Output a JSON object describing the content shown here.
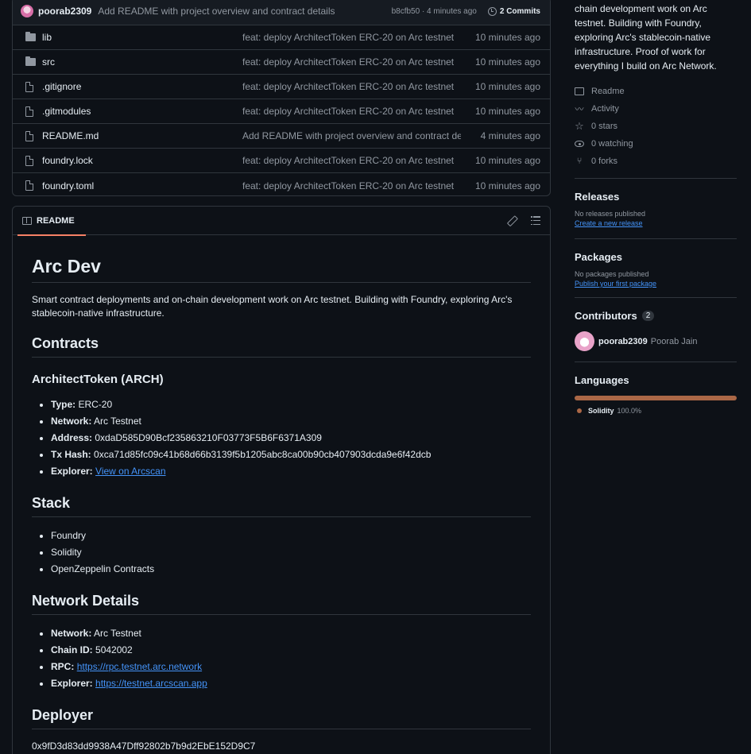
{
  "commit": {
    "user": "poorab2309",
    "message": "Add README with project overview and contract details",
    "meta": "b8cfb50 · 4 minutes ago",
    "commits_label": "2 Commits"
  },
  "files": [
    {
      "name": "lib",
      "type": "folder",
      "commit": "feat: deploy ArchitectToken ERC-20 on Arc testnet",
      "time": "10 minutes ago"
    },
    {
      "name": "src",
      "type": "folder",
      "commit": "feat: deploy ArchitectToken ERC-20 on Arc testnet",
      "time": "10 minutes ago"
    },
    {
      "name": ".gitignore",
      "type": "file",
      "commit": "feat: deploy ArchitectToken ERC-20 on Arc testnet",
      "time": "10 minutes ago"
    },
    {
      "name": ".gitmodules",
      "type": "file",
      "commit": "feat: deploy ArchitectToken ERC-20 on Arc testnet",
      "time": "10 minutes ago"
    },
    {
      "name": "README.md",
      "type": "file",
      "commit": "Add README with project overview and contract details",
      "time": "4 minutes ago"
    },
    {
      "name": "foundry.lock",
      "type": "file",
      "commit": "feat: deploy ArchitectToken ERC-20 on Arc testnet",
      "time": "10 minutes ago"
    },
    {
      "name": "foundry.toml",
      "type": "file",
      "commit": "feat: deploy ArchitectToken ERC-20 on Arc testnet",
      "time": "10 minutes ago"
    }
  ],
  "readme": {
    "tab_label": "README",
    "title": "Arc Dev",
    "intro": "Smart contract deployments and on-chain development work on Arc testnet. Building with Foundry, exploring Arc's stablecoin-native infrastructure.",
    "contracts_heading": "Contracts",
    "token_heading": "ArchitectToken (ARCH)",
    "token_items": [
      {
        "label": "Type:",
        "value": "ERC-20"
      },
      {
        "label": "Network:",
        "value": "Arc Testnet"
      },
      {
        "label": "Address:",
        "value": "0xdaD585D90Bcf235863210F03773F5B6F6371A309"
      },
      {
        "label": "Tx Hash:",
        "value": "0xca71d85fc09c41b68d66b3139f5b1205abc8ca00b90cb407903dcda9e6f42dcb"
      }
    ],
    "explorer_label": "Explorer:",
    "explorer_link": "View on Arcscan",
    "stack_heading": "Stack",
    "stack_items": [
      "Foundry",
      "Solidity",
      "OpenZeppelin Contracts"
    ],
    "network_heading": "Network Details",
    "network_items": [
      {
        "label": "Network:",
        "value": "Arc Testnet"
      },
      {
        "label": "Chain ID:",
        "value": "5042002"
      }
    ],
    "rpc_label": "RPC:",
    "rpc_link": "https://rpc.testnet.arc.network",
    "net_explorer_label": "Explorer:",
    "net_explorer_link": "https://testnet.arcscan.app",
    "deployer_heading": "Deployer",
    "deployer_address": "0x9fD3d83dd9938A47Dff92802b7b9d2EbE152D9C7"
  },
  "sidebar": {
    "about": "chain development work on Arc testnet. Building with Foundry, exploring Arc's stablecoin-native infrastructure. Proof of work for everything I build on Arc Network.",
    "readme": "Readme",
    "activity": "Activity",
    "stars": "0 stars",
    "watching": "0 watching",
    "forks": "0 forks",
    "releases_heading": "Releases",
    "releases_none": "No releases published",
    "releases_link": "Create a new release",
    "packages_heading": "Packages",
    "packages_none": "No packages published",
    "packages_link": "Publish your first package",
    "contributors_heading": "Contributors",
    "contributors_count": "2",
    "contributor_user": "poorab2309",
    "contributor_name": "Poorab Jain",
    "languages_heading": "Languages",
    "language_name": "Solidity",
    "language_pct": "100.0%",
    "language_color": "#aa6746"
  }
}
